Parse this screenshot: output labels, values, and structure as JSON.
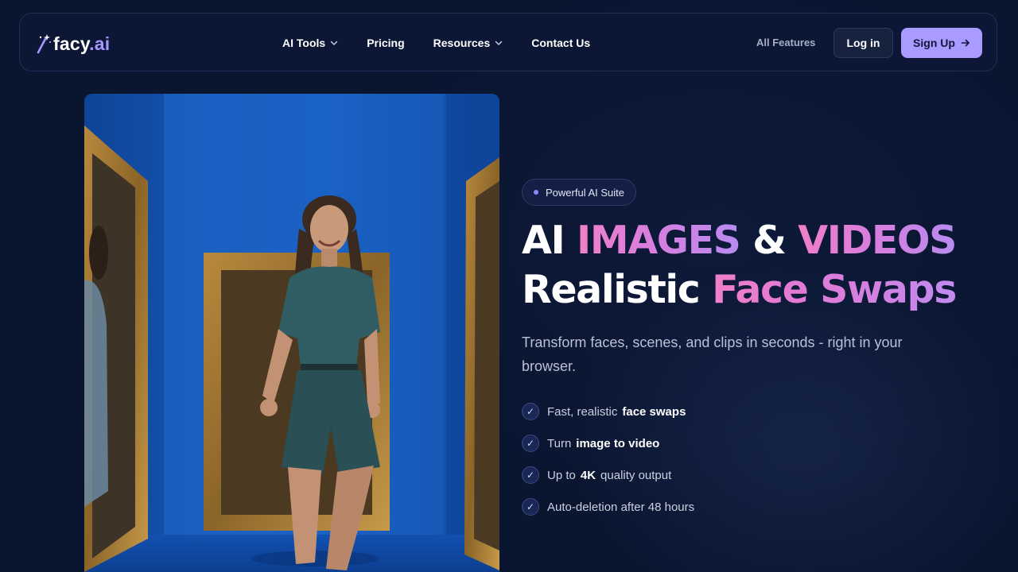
{
  "brand": {
    "name": "facy",
    "tld": ".ai",
    "icon": "magic-wand-icon"
  },
  "nav": {
    "items": [
      {
        "label": "AI Tools",
        "dropdown": true
      },
      {
        "label": "Pricing",
        "dropdown": false
      },
      {
        "label": "Resources",
        "dropdown": true
      },
      {
        "label": "Contact Us",
        "dropdown": false
      }
    ],
    "all_features": "All Features",
    "login": "Log in",
    "signup": "Sign Up"
  },
  "hero": {
    "badge": "Powerful AI Suite",
    "headline": {
      "line1": {
        "w1": "AI",
        "g1": "IMAGES",
        "amp": "&",
        "g2": "VIDEOS"
      },
      "line2": {
        "w1": "Realistic",
        "g1": "Face Swaps"
      }
    },
    "subtitle": "Transform faces, scenes, and clips in seconds - right in your browser.",
    "features": [
      {
        "pre": "Fast, realistic",
        "bold": "face swaps",
        "post": ""
      },
      {
        "pre": "Turn",
        "bold": "image to video",
        "post": ""
      },
      {
        "pre": "Up to",
        "bold": "4K",
        "post": "quality output"
      },
      {
        "pre": "Auto-deletion after 48 hours",
        "bold": "",
        "post": ""
      }
    ]
  },
  "colors": {
    "background": "#0a1530",
    "accent": "#a99bff",
    "gradient_start": "#f07fc8",
    "gradient_end": "#b88cf0",
    "image_backdrop": "#1559b8"
  }
}
